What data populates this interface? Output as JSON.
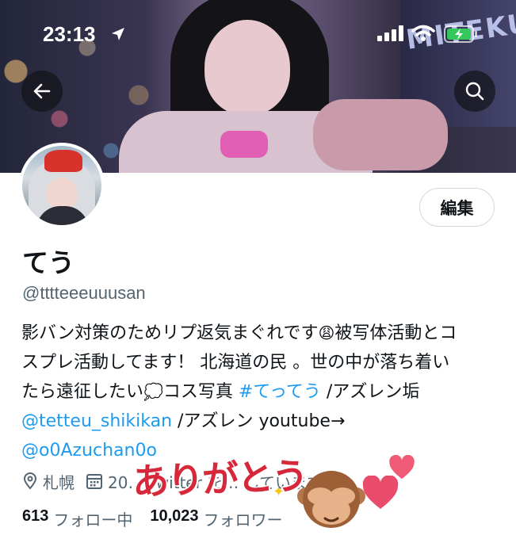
{
  "status_bar": {
    "time": "23:13",
    "icons": [
      "location-arrow-icon",
      "signal-icon",
      "wifi-icon",
      "battery-charging-icon"
    ]
  },
  "header": {
    "neon_sign_text": "MITEKU"
  },
  "profile": {
    "edit_label": "編集",
    "display_name": "てう",
    "handle": "@tttteeeuuusan",
    "bio": {
      "line1_a": "影バン対策のためリプ返気まぐれです",
      "line1_b": "被写体活動とコ",
      "line2": "スプレ活動してます！ 北海道の民 。世の中が落ち着い",
      "line3_a": "たら遠征したい",
      "line3_b": "コス写真 ",
      "line3_tag": "#てってう",
      "line3_c": " /アズレン垢",
      "line4_mention": "@tetteu_shikikan",
      "line4_rest": " /アズレン youtube→",
      "line5_mention": "@o0Azuchan0o"
    },
    "location": "札幌",
    "joined": "20… Twitter を… しています",
    "following_count": "613",
    "following_label": "フォロー中",
    "followers_count": "10,023",
    "followers_label": "フォロワー"
  },
  "overlay": {
    "sticker_text": "ありがとう"
  },
  "colors": {
    "link": "#1d9bf0",
    "secondary_text": "#536471",
    "sticker_red": "#d6283a",
    "heart_pink": "#e94b6a"
  }
}
